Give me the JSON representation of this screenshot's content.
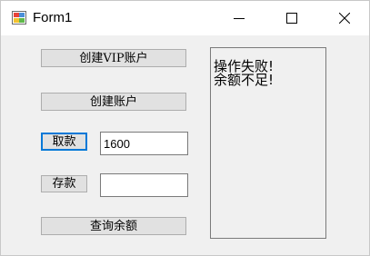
{
  "window": {
    "title": "Form1",
    "icons": {
      "app": "winforms-app-icon",
      "minimize": "minimize-icon",
      "maximize": "maximize-icon",
      "close": "close-icon"
    }
  },
  "buttons": {
    "create_vip": "创建VIP账户",
    "create_account": "创建账户",
    "withdraw": "取款",
    "deposit": "存款",
    "query_balance": "查询余额"
  },
  "inputs": {
    "withdraw_amount": "1600",
    "deposit_amount": ""
  },
  "output": {
    "lines": [
      "操作失败!",
      "余额不足!"
    ]
  },
  "colors": {
    "focus_border": "#0078d7",
    "button_face": "#e1e1e1",
    "form_background": "#f0f0f0"
  }
}
